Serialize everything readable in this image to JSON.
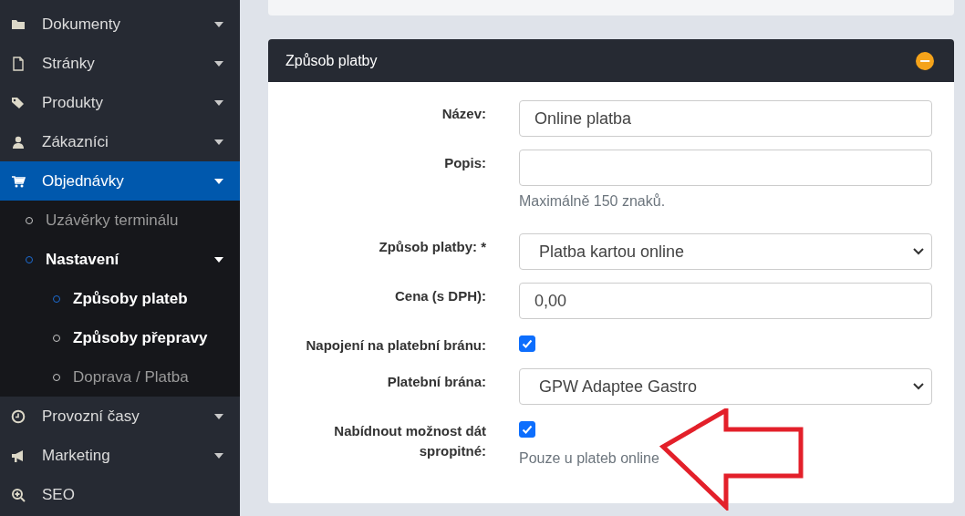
{
  "sidebar": {
    "items": [
      {
        "label": "Dokumenty",
        "selected": false,
        "has_children": true
      },
      {
        "label": "Stránky",
        "selected": false,
        "has_children": true
      },
      {
        "label": "Produkty",
        "selected": false,
        "has_children": true
      },
      {
        "label": "Zákazníci",
        "selected": false,
        "has_children": true
      },
      {
        "label": "Objednávky",
        "selected": true,
        "has_children": true,
        "children": [
          {
            "label": "Uzávěrky terminálu",
            "selected": false,
            "highlighted": false,
            "has_children": false
          },
          {
            "label": "Nastavení",
            "selected": true,
            "highlighted": false,
            "has_children": true,
            "children": [
              {
                "label": "Způsoby plateb",
                "selected": true,
                "highlighted": false
              },
              {
                "label": "Způsoby přepravy",
                "selected": false,
                "highlighted": true
              },
              {
                "label": "Doprava / Platba",
                "selected": false,
                "highlighted": false
              }
            ]
          }
        ]
      },
      {
        "label": "Provozní časy",
        "selected": false,
        "has_children": true
      },
      {
        "label": "Marketing",
        "selected": false,
        "has_children": true
      },
      {
        "label": "SEO",
        "selected": false,
        "has_children": false
      }
    ]
  },
  "panel": {
    "title": "Způsob platby",
    "collapse_button": "−",
    "fields": [
      {
        "kind": "text",
        "label": "Název:",
        "value": "Online platba"
      },
      {
        "kind": "text",
        "label": "Popis:",
        "help": "Maximálně 150 znaků."
      },
      {
        "kind": "select",
        "label": "Způsob platby: *",
        "value": "Platba kartou online"
      },
      {
        "kind": "text",
        "label": "Cena (s DPH):",
        "value": "0,00"
      },
      {
        "kind": "checkbox",
        "label": "Napojení na platební bránu:",
        "checked": true
      },
      {
        "kind": "select",
        "label": "Platební brána:",
        "value": "GPW Adaptee Gastro"
      },
      {
        "kind": "checkbox",
        "label": "Nabídnout možnost dát spropitné:",
        "checked": true,
        "help": "Pouze u plateb online"
      }
    ]
  }
}
